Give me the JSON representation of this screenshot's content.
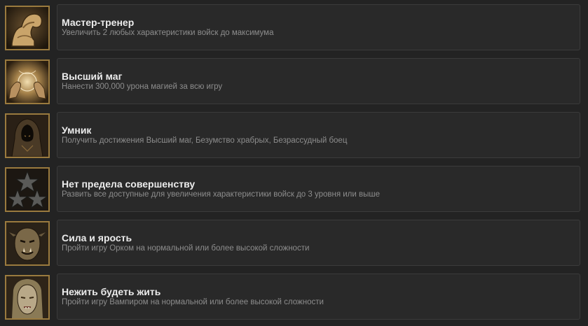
{
  "achievements": [
    {
      "icon": "flexed-arm-icon",
      "title": "Мастер-тренер",
      "description": "Увеличить 2 любых характеристики войск до максимума"
    },
    {
      "icon": "magic-orb-hands-icon",
      "title": "Высший маг",
      "description": "Нанести 300,000 урона магией за всю игру"
    },
    {
      "icon": "hooded-figure-icon",
      "title": "Умник",
      "description": "Получить достижения Высший маг, Безумство храбрых, Безрассудный боец"
    },
    {
      "icon": "three-stars-icon",
      "title": "Нет предела совершенству",
      "description": "Развить все доступные для увеличения характеристики войск до 3 уровня или выше"
    },
    {
      "icon": "orc-portrait-icon",
      "title": "Сила и ярость",
      "description": "Пройти игру Орком на нормальной или более высокой сложности"
    },
    {
      "icon": "vampire-portrait-icon",
      "title": "Нежить будеть жить",
      "description": "Пройти игру Вампиром на нормальной или более высокой сложности"
    }
  ],
  "colors": {
    "background": "#232323",
    "card": "#292929",
    "icon_frame": "#9a7a3e",
    "title": "#ececec",
    "description": "#8d8d8d"
  }
}
